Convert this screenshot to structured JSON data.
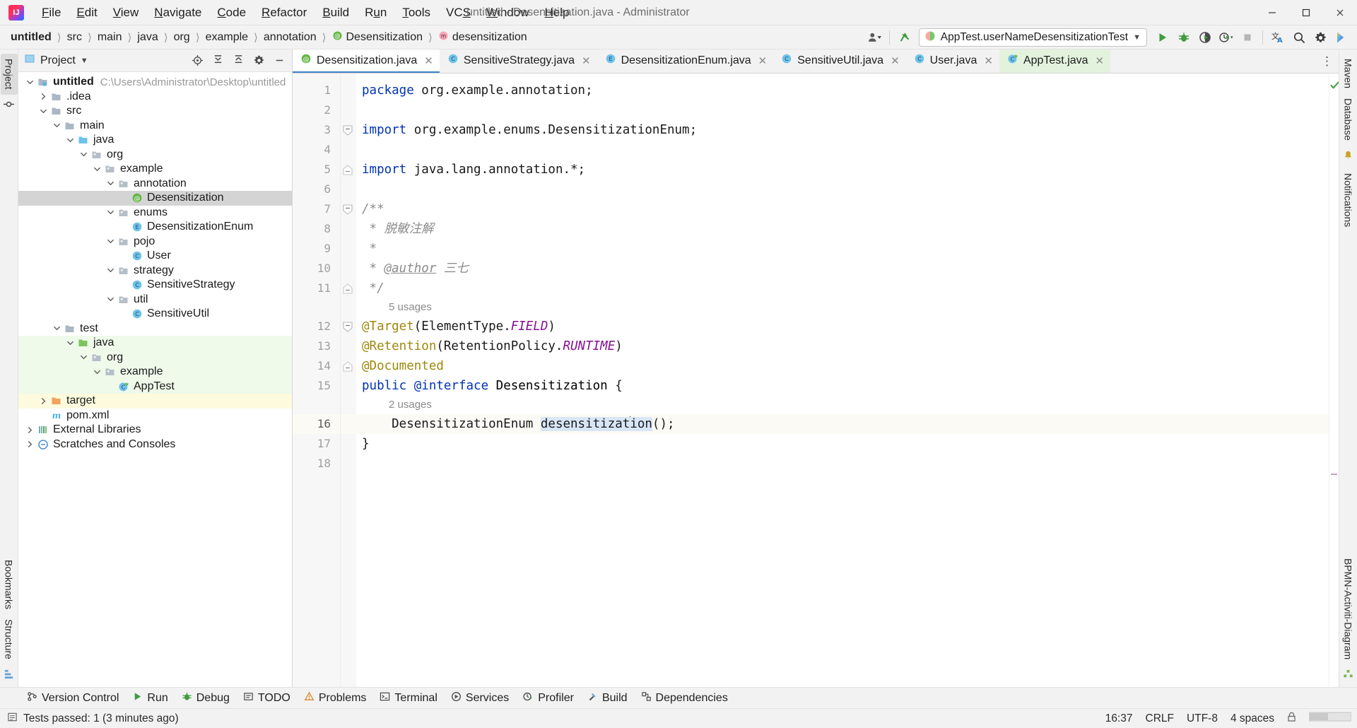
{
  "titlebar": {
    "logo_icon": "intellij-idea-logo",
    "window_title": "untitled - Desensitization.java - Administrator",
    "menus": [
      {
        "label": "File"
      },
      {
        "label": "Edit"
      },
      {
        "label": "View"
      },
      {
        "label": "Navigate"
      },
      {
        "label": "Code"
      },
      {
        "label": "Refactor"
      },
      {
        "label": "Build"
      },
      {
        "label": "Run"
      },
      {
        "label": "Tools"
      },
      {
        "label": "VCS"
      },
      {
        "label": "Window"
      },
      {
        "label": "Help"
      }
    ],
    "minimize_label": "Minimize",
    "maximize_label": "Maximize",
    "close_label": "Close"
  },
  "navbar": {
    "crumbs": [
      "untitled",
      "src",
      "main",
      "java",
      "org",
      "example",
      "annotation",
      "Desensitization",
      "desensitization"
    ],
    "separator": "〉",
    "run_config": "AppTest.userNameDesensitizationTest",
    "account_icon": "account-icon",
    "updates_icon": "updates-arrow-icon",
    "run_icon": "run-icon",
    "debug_icon": "debug-icon",
    "coverage_icon": "run-with-coverage-icon",
    "profiler_icon": "profiler-icon",
    "stop_icon": "stop-icon",
    "translate_icon": "translate-icon",
    "search_icon": "search-icon",
    "settings_icon": "settings-gear-icon",
    "ai_icon": "ai-assistant-icon"
  },
  "left_strip": {
    "tabs": [
      {
        "label": "Project",
        "active": true
      },
      {
        "label": "Bookmarks",
        "active": false
      },
      {
        "label": "Structure",
        "active": false
      }
    ],
    "commit_icon": "commit-icon",
    "structure_icon": "structure-icon"
  },
  "right_strip": {
    "tabs": [
      {
        "label": "Maven"
      },
      {
        "label": "Database"
      },
      {
        "label": "Notifications"
      },
      {
        "label": "BPMN-Activiti-Diagram"
      }
    ]
  },
  "project_panel": {
    "title": "Project",
    "title_icon": "project-icon",
    "chevron_icon": "chevron-down-icon",
    "actions": [
      {
        "name": "select-opened-file-icon"
      },
      {
        "name": "expand-all-icon"
      },
      {
        "name": "collapse-all-icon"
      },
      {
        "name": "settings-gear-icon"
      },
      {
        "name": "hide-icon"
      }
    ],
    "tree": [
      {
        "depth": 0,
        "label": "untitled",
        "hint": "C:\\Users\\Administrator\\Desktop\\untitled",
        "icon": "module-folder-icon",
        "arrow": "down",
        "bold": true,
        "bg": "none"
      },
      {
        "depth": 1,
        "label": ".idea",
        "icon": "folder-icon",
        "arrow": "right",
        "bg": "none"
      },
      {
        "depth": 1,
        "label": "src",
        "icon": "folder-icon",
        "arrow": "down",
        "bg": "none"
      },
      {
        "depth": 2,
        "label": "main",
        "icon": "folder-icon",
        "arrow": "down",
        "bg": "none"
      },
      {
        "depth": 3,
        "label": "java",
        "icon": "source-root-icon",
        "arrow": "down",
        "bg": "none"
      },
      {
        "depth": 4,
        "label": "org",
        "icon": "package-icon",
        "arrow": "down",
        "bg": "none"
      },
      {
        "depth": 5,
        "label": "example",
        "icon": "package-icon",
        "arrow": "down",
        "bg": "none"
      },
      {
        "depth": 6,
        "label": "annotation",
        "icon": "package-icon",
        "arrow": "down",
        "bg": "none"
      },
      {
        "depth": 7,
        "label": "Desensitization",
        "icon": "annotation-class-icon",
        "arrow": "none",
        "bg": "selected"
      },
      {
        "depth": 6,
        "label": "enums",
        "icon": "package-icon",
        "arrow": "down",
        "bg": "none"
      },
      {
        "depth": 7,
        "label": "DesensitizationEnum",
        "icon": "enum-class-icon",
        "arrow": "none",
        "bg": "none"
      },
      {
        "depth": 6,
        "label": "pojo",
        "icon": "package-icon",
        "arrow": "down",
        "bg": "none"
      },
      {
        "depth": 7,
        "label": "User",
        "icon": "java-class-icon",
        "arrow": "none",
        "bg": "none"
      },
      {
        "depth": 6,
        "label": "strategy",
        "icon": "package-icon",
        "arrow": "down",
        "bg": "none"
      },
      {
        "depth": 7,
        "label": "SensitiveStrategy",
        "icon": "java-class-icon",
        "arrow": "none",
        "bg": "none"
      },
      {
        "depth": 6,
        "label": "util",
        "icon": "package-icon",
        "arrow": "down",
        "bg": "none"
      },
      {
        "depth": 7,
        "label": "SensitiveUtil",
        "icon": "java-class-icon",
        "arrow": "none",
        "bg": "none"
      },
      {
        "depth": 2,
        "label": "test",
        "icon": "folder-icon",
        "arrow": "down",
        "bg": "none"
      },
      {
        "depth": 3,
        "label": "java",
        "icon": "test-source-root-icon",
        "arrow": "down",
        "bg": "green"
      },
      {
        "depth": 4,
        "label": "org",
        "icon": "package-icon",
        "arrow": "down",
        "bg": "green"
      },
      {
        "depth": 5,
        "label": "example",
        "icon": "package-icon",
        "arrow": "down",
        "bg": "green"
      },
      {
        "depth": 6,
        "label": "AppTest",
        "icon": "test-class-icon",
        "arrow": "none",
        "bg": "green"
      },
      {
        "depth": 1,
        "label": "target",
        "icon": "excluded-folder-icon",
        "arrow": "right",
        "bg": "yellow"
      },
      {
        "depth": 1,
        "label": "pom.xml",
        "icon": "maven-file-icon",
        "arrow": "none",
        "bg": "none"
      },
      {
        "depth": 0,
        "label": "External Libraries",
        "icon": "libraries-icon",
        "arrow": "right",
        "bg": "none"
      },
      {
        "depth": 0,
        "label": "Scratches and Consoles",
        "icon": "scratches-icon",
        "arrow": "right",
        "bg": "none"
      }
    ]
  },
  "editor_tabs": [
    {
      "label": "Desensitization.java",
      "icon": "annotation-class-icon",
      "active": true,
      "test": false
    },
    {
      "label": "SensitiveStrategy.java",
      "icon": "java-class-icon",
      "active": false,
      "test": false
    },
    {
      "label": "DesensitizationEnum.java",
      "icon": "enum-class-icon",
      "active": false,
      "test": false
    },
    {
      "label": "SensitiveUtil.java",
      "icon": "java-class-icon",
      "active": false,
      "test": false
    },
    {
      "label": "User.java",
      "icon": "java-class-icon",
      "active": false,
      "test": false
    },
    {
      "label": "AppTest.java",
      "icon": "test-class-icon",
      "active": false,
      "test": true
    }
  ],
  "editor_tabs_more_icon": "more-options-icon",
  "editor": {
    "inspection_status_icon": "no-problems-checkmark",
    "lines": [
      {
        "num": "1",
        "fold": "none",
        "tokens": [
          {
            "t": "package ",
            "c": "kw"
          },
          {
            "t": "org.example.annotation;",
            "c": "ident"
          }
        ]
      },
      {
        "num": "2",
        "fold": "none",
        "tokens": []
      },
      {
        "num": "3",
        "fold": "start",
        "tokens": [
          {
            "t": "import ",
            "c": "kw"
          },
          {
            "t": "org.example.enums.DesensitizationEnum;",
            "c": "ident"
          }
        ]
      },
      {
        "num": "4",
        "fold": "none",
        "tokens": []
      },
      {
        "num": "5",
        "fold": "end",
        "tokens": [
          {
            "t": "import ",
            "c": "kw"
          },
          {
            "t": "java.lang.annotation.*;",
            "c": "ident"
          }
        ]
      },
      {
        "num": "6",
        "fold": "none",
        "tokens": []
      },
      {
        "num": "7",
        "fold": "start",
        "tokens": [
          {
            "t": "/**",
            "c": "cmt"
          }
        ]
      },
      {
        "num": "8",
        "fold": "none",
        "tokens": [
          {
            "t": " * ",
            "c": "cmt"
          },
          {
            "t": "脱敏注解",
            "c": "cmt"
          }
        ]
      },
      {
        "num": "9",
        "fold": "none",
        "tokens": [
          {
            "t": " *",
            "c": "cmt"
          }
        ]
      },
      {
        "num": "10",
        "fold": "none",
        "tokens": [
          {
            "t": " * ",
            "c": "cmt"
          },
          {
            "t": "@author",
            "c": "cmt-tag"
          },
          {
            "t": " 三七",
            "c": "cmt"
          }
        ]
      },
      {
        "num": "11",
        "fold": "end",
        "tokens": [
          {
            "t": " */",
            "c": "cmt"
          }
        ]
      },
      {
        "num": "",
        "fold": "none",
        "inlay": "5 usages"
      },
      {
        "num": "12",
        "fold": "start",
        "tokens": [
          {
            "t": "@Target",
            "c": "ann"
          },
          {
            "t": "(ElementType.",
            "c": "ident"
          },
          {
            "t": "FIELD",
            "c": "const"
          },
          {
            "t": ")",
            "c": "ident"
          }
        ]
      },
      {
        "num": "13",
        "fold": "none",
        "tokens": [
          {
            "t": "@Retention",
            "c": "ann"
          },
          {
            "t": "(RetentionPolicy.",
            "c": "ident"
          },
          {
            "t": "RUNTIME",
            "c": "const"
          },
          {
            "t": ")",
            "c": "ident"
          }
        ]
      },
      {
        "num": "14",
        "fold": "end",
        "tokens": [
          {
            "t": "@Documented",
            "c": "ann"
          }
        ]
      },
      {
        "num": "15",
        "fold": "none",
        "tokens": [
          {
            "t": "public ",
            "c": "kw"
          },
          {
            "t": "@interface",
            "c": "kw"
          },
          {
            "t": " ",
            "c": "ident"
          },
          {
            "t": "Desensitization",
            "c": "cls"
          },
          {
            "t": " {",
            "c": "ident"
          }
        ]
      },
      {
        "num": "",
        "fold": "none",
        "inlay": "2 usages"
      },
      {
        "num": "16",
        "fold": "none",
        "current": true,
        "tokens": [
          {
            "t": "    DesensitizationEnum ",
            "c": "ident"
          },
          {
            "t": "desensitiz",
            "c": "sel"
          },
          {
            "t": "at",
            "c": "sel-caret"
          },
          {
            "t": "ion",
            "c": "sel"
          },
          {
            "t": "();",
            "c": "ident"
          }
        ]
      },
      {
        "num": "17",
        "fold": "none",
        "tokens": [
          {
            "t": "}",
            "c": "ident"
          }
        ]
      },
      {
        "num": "18",
        "fold": "none",
        "tokens": []
      }
    ]
  },
  "bottom_bar": {
    "tools": [
      {
        "label": "Version Control",
        "icon": "version-control-icon"
      },
      {
        "label": "Run",
        "icon": "run-icon"
      },
      {
        "label": "Debug",
        "icon": "debug-icon"
      },
      {
        "label": "TODO",
        "icon": "todo-icon"
      },
      {
        "label": "Problems",
        "icon": "problems-icon"
      },
      {
        "label": "Terminal",
        "icon": "terminal-icon"
      },
      {
        "label": "Services",
        "icon": "services-icon"
      },
      {
        "label": "Profiler",
        "icon": "profiler-icon"
      },
      {
        "label": "Build",
        "icon": "build-hammer-icon"
      },
      {
        "label": "Dependencies",
        "icon": "dependencies-icon"
      }
    ]
  },
  "statusbar": {
    "message_icon": "event-log-icon",
    "message": "Tests passed: 1 (3 minutes ago)",
    "time": "16:37",
    "line_separator": "CRLF",
    "encoding": "UTF-8",
    "indent": "4 spaces",
    "lock_icon": "read-only-lock-icon",
    "memory_icon": "memory-indicator"
  },
  "colors": {
    "accent_blue": "#4083c9",
    "keyword": "#0033b3",
    "annotation": "#9e880d",
    "constant": "#871094",
    "comment": "#8c8c8c",
    "test_green": "#e3f2dd",
    "selection": "#d8e6f7"
  }
}
